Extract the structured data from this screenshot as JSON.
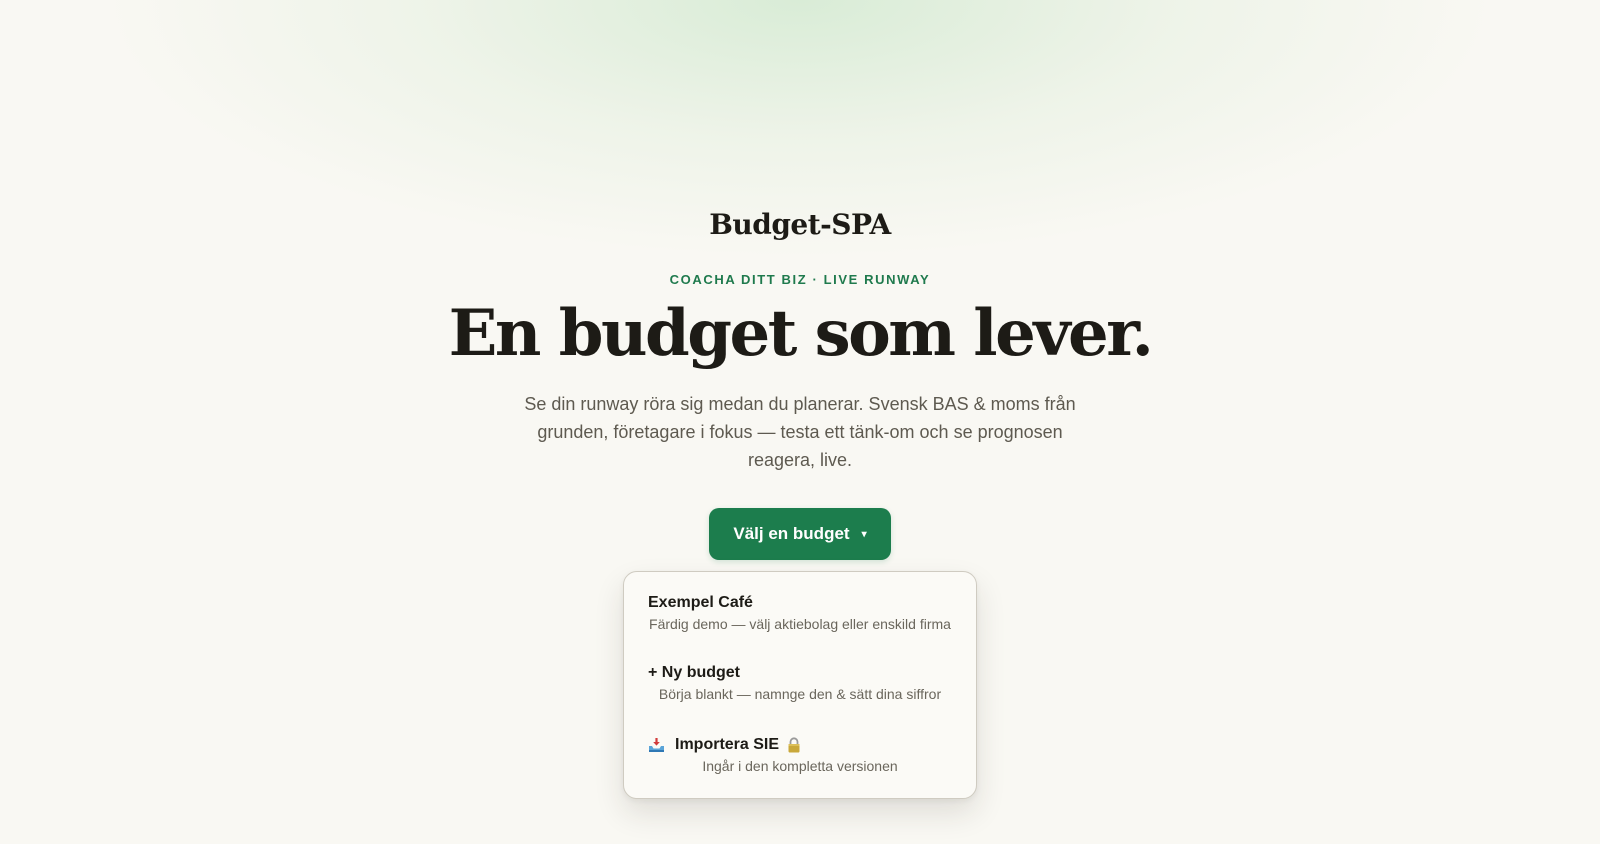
{
  "brand": "Budget-SPA",
  "eyebrow": "COACHA DITT BIZ · LIVE RUNWAY",
  "headline": "En budget som lever.",
  "lede": "Se din runway röra sig medan du planerar. Svensk BAS & moms från grunden, företagare i fokus — testa ett tänk-om och se prognosen reagera, live.",
  "cta": {
    "label": "Välj en budget",
    "caret": "▾"
  },
  "menu": {
    "items": [
      {
        "title": "Exempel Café",
        "description": "Färdig demo — välj aktiebolag eller enskild firma"
      },
      {
        "title": "+ Ny budget",
        "description": "Börja blankt — namnge den & sätt dina siffror"
      },
      {
        "title": "Importera SIE",
        "description": "Ingår i den kompletta versionen",
        "icon": "inbox-tray-icon",
        "badge_icon": "lock-icon",
        "locked": true
      }
    ]
  },
  "colors": {
    "background": "#f9f8f3",
    "accent": "#1c7d4d",
    "eyebrow": "#1f7a4d",
    "text": "#1d1b16",
    "muted": "#5e5a50"
  }
}
